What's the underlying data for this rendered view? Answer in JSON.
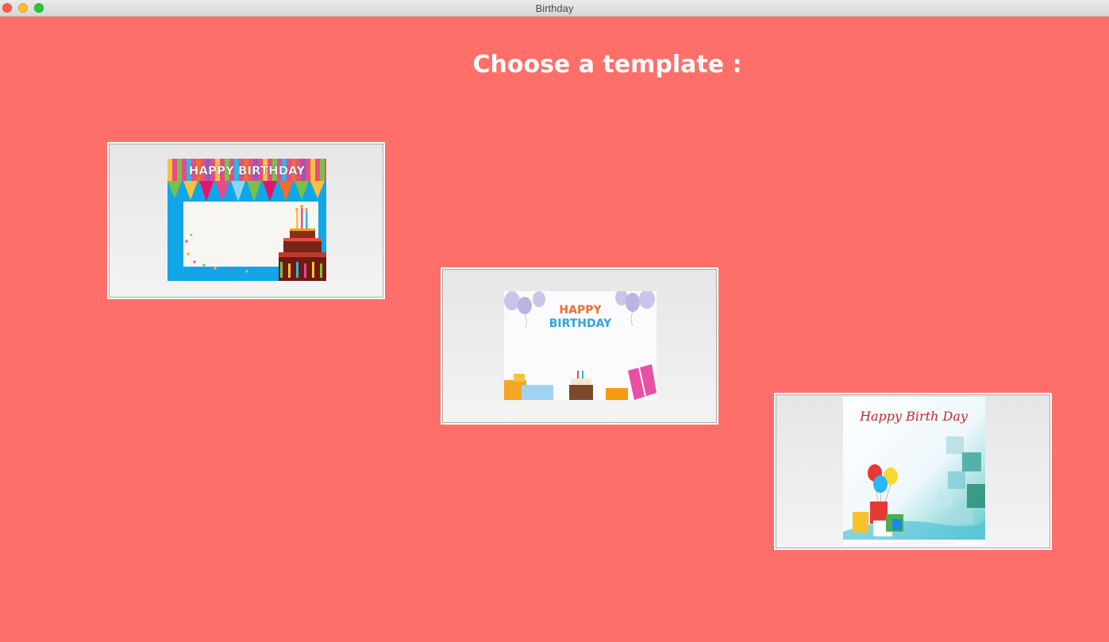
{
  "window": {
    "title": "Birthday"
  },
  "page": {
    "heading": "Choose a template :"
  },
  "templates": [
    {
      "banner_text": "HAPPY BIRTHDAY"
    },
    {
      "banner_line1": "HAPPY",
      "banner_line2": "BIRTHDAY"
    },
    {
      "banner_text": "Happy Birth Day"
    }
  ],
  "colors": {
    "background": "#ff6f6a",
    "card_border": "#a9a9a9",
    "heading": "#ffffff"
  }
}
